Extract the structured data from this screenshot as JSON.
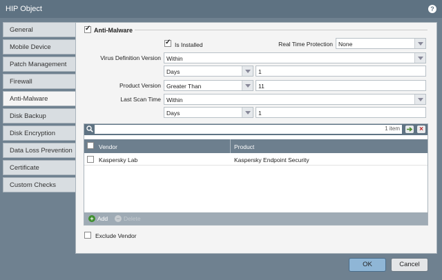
{
  "window": {
    "title": "HIP Object",
    "help_icon": "help-icon"
  },
  "tabs": [
    {
      "label": "General",
      "active": false
    },
    {
      "label": "Mobile Device",
      "active": false
    },
    {
      "label": "Patch Management",
      "active": false
    },
    {
      "label": "Firewall",
      "active": false
    },
    {
      "label": "Anti-Malware",
      "active": true
    },
    {
      "label": "Disk Backup",
      "active": false
    },
    {
      "label": "Disk Encryption",
      "active": false
    },
    {
      "label": "Data Loss Prevention",
      "active": false
    },
    {
      "label": "Certificate",
      "active": false
    },
    {
      "label": "Custom Checks",
      "active": false
    }
  ],
  "anti_malware": {
    "section_label": "Anti-Malware",
    "section_checked": true,
    "is_installed_label": "Is Installed",
    "is_installed_checked": true,
    "rtp_label": "Real Time Protection",
    "rtp_value": "None",
    "vdv_label": "Virus Definition Version",
    "vdv_value": "Within",
    "vdv_unit": "Days",
    "vdv_number": "1",
    "pv_label": "Product Version",
    "pv_value": "Greater Than",
    "pv_number": "11",
    "lst_label": "Last Scan Time",
    "lst_value": "Within",
    "lst_unit": "Days",
    "lst_number": "1"
  },
  "grid": {
    "search_value": "",
    "count": "1 item",
    "columns": {
      "vendor": "Vendor",
      "product": "Product"
    },
    "rows": [
      {
        "vendor": "Kaspersky Lab",
        "product": "Kaspersky Endpoint Security",
        "checked": false
      }
    ],
    "add_label": "Add",
    "delete_label": "Delete"
  },
  "exclude_vendor_label": "Exclude Vendor",
  "exclude_vendor_checked": false,
  "buttons": {
    "ok": "OK",
    "cancel": "Cancel"
  },
  "colors": {
    "titlebar": "#5e7282",
    "accent": "#8fb6d6"
  }
}
